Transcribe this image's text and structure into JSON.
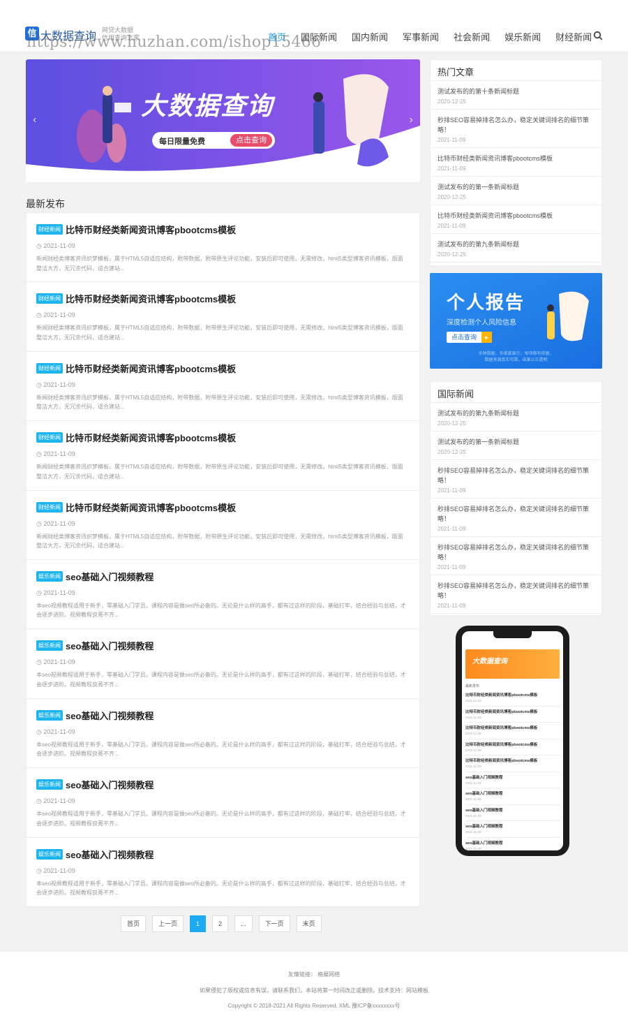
{
  "header": {
    "logo_icon": "信",
    "logo_name": "大数据查询",
    "slogan1": "网贷大数据",
    "slogan2": "信用查询之家",
    "watermark": "https://www.huzhan.com/ishop15466",
    "nav": [
      "首页",
      "国际新闻",
      "国内新闻",
      "军事新闻",
      "社会新闻",
      "娱乐新闻",
      "财经新闻"
    ],
    "active": "首页"
  },
  "banner": {
    "title": "大数据查询",
    "pill": "每日限量免费",
    "btn": "点击查询",
    "colors": {
      "bg1": "#5b4fe0",
      "bg2": "#8f54e8"
    }
  },
  "latest": {
    "title": "最新发布",
    "articles": [
      {
        "tag": "财经新闻",
        "title": "比特币财经类新闻资讯博客pbootcms模板",
        "date": "2021-11-09",
        "desc": "新闻财经类博客资讯织梦模板，属于HTML5自适应结构，附带数据，附带原生评论功能，安装后即可使用，无需修改。html5类型博客资讯模板，版面整洁大方，无冗余代码，适合建站..."
      },
      {
        "tag": "财经新闻",
        "title": "比特币财经类新闻资讯博客pbootcms模板",
        "date": "2021-11-09",
        "desc": "新闻财经类博客资讯织梦模板，属于HTML5自适应结构，附带数据，附带原生评论功能，安装后即可使用，无需修改。html5类型博客资讯模板，版面整洁大方，无冗余代码，适合建站..."
      },
      {
        "tag": "财经新闻",
        "title": "比特币财经类新闻资讯博客pbootcms模板",
        "date": "2021-11-09",
        "desc": "新闻财经类博客资讯织梦模板，属于HTML5自适应结构，附带数据，附带原生评论功能，安装后即可使用，无需修改。html5类型博客资讯模板，版面整洁大方，无冗余代码，适合建站..."
      },
      {
        "tag": "财经新闻",
        "title": "比特币财经类新闻资讯博客pbootcms模板",
        "date": "2021-11-09",
        "desc": "新闻财经类博客资讯织梦模板，属于HTML5自适应结构，附带数据，附带原生评论功能，安装后即可使用，无需修改。html5类型博客资讯模板，版面整洁大方，无冗余代码，适合建站..."
      },
      {
        "tag": "财经新闻",
        "title": "比特币财经类新闻资讯博客pbootcms模板",
        "date": "2021-11-09",
        "desc": "新闻财经类博客资讯织梦模板，属于HTML5自适应结构，附带数据，附带原生评论功能，安装后即可使用，无需修改。html5类型博客资讯模板，版面整洁大方，无冗余代码，适合建站..."
      },
      {
        "tag": "娱乐新闻",
        "title": "seo基础入门视频教程",
        "date": "2021-11-09",
        "desc": "本seo视频教程适用于新手，零基础入门学员。课程内容是做seo所必备的。无论是什么样的高手，都有过这样的阶段，基础打牢，结合经验与总结，才会逐步进阶。视频教程良莠不齐..."
      },
      {
        "tag": "娱乐新闻",
        "title": "seo基础入门视频教程",
        "date": "2021-11-09",
        "desc": "本seo视频教程适用于新手，零基础入门学员。课程内容是做seo所必备的。无论是什么样的高手，都有过这样的阶段，基础打牢，结合经验与总结，才会逐步进阶。视频教程良莠不齐..."
      },
      {
        "tag": "娱乐新闻",
        "title": "seo基础入门视频教程",
        "date": "2021-11-09",
        "desc": "本seo视频教程适用于新手，零基础入门学员。课程内容是做seo所必备的。无论是什么样的高手，都有过这样的阶段，基础打牢，结合经验与总结，才会逐步进阶。视频教程良莠不齐..."
      },
      {
        "tag": "娱乐新闻",
        "title": "seo基础入门视频教程",
        "date": "2021-11-09",
        "desc": "本seo视频教程适用于新手，零基础入门学员。课程内容是做seo所必备的。无论是什么样的高手，都有过这样的阶段，基础打牢，结合经验与总结，才会逐步进阶。视频教程良莠不齐..."
      },
      {
        "tag": "娱乐新闻",
        "title": "seo基础入门视频教程",
        "date": "2021-11-09",
        "desc": "本seo视频教程适用于新手，零基础入门学员。课程内容是做seo所必备的。无论是什么样的高手，都有过这样的阶段，基础打牢，结合经验与总结，才会逐步进阶。视频教程良莠不齐..."
      }
    ],
    "tag_colors": {
      "财经新闻": "#1eb4f0",
      "娱乐新闻": "#1eb4f0"
    }
  },
  "pager": {
    "items": [
      "首页",
      "上一页",
      "1",
      "2",
      "...",
      "下一页",
      "末页"
    ],
    "current": "1"
  },
  "hot": {
    "title": "热门文章",
    "items": [
      {
        "t": "测试发布的的第十条新闻标题",
        "d": "2020-12-25"
      },
      {
        "t": "秒排SEO容易掉排名怎么办，稳定关键词排名的细节策略！",
        "d": "2021-11-09"
      },
      {
        "t": "比特币财经类新闻资讯博客pbootcms模板",
        "d": "2021-11-09"
      },
      {
        "t": "测试发布的的第一条新闻标题",
        "d": "2020-12-25"
      },
      {
        "t": "比特币财经类新闻资讯博客pbootcms模板",
        "d": "2021-11-09"
      },
      {
        "t": "测试发布的的第九条新闻标题",
        "d": "2020-12-25"
      }
    ]
  },
  "ad": {
    "title": "个人报告",
    "sub": "深度检测个人风险信息",
    "btn": "点击查询",
    "fine1": "多种数据，多维度展示，每项都有依据，",
    "fine2": "数据来源真实可靠，结果公正透明"
  },
  "intl": {
    "title": "国际新闻",
    "items": [
      {
        "t": "测试发布的的第九条新闻标题",
        "d": "2020-12-25"
      },
      {
        "t": "测试发布的的第一条新闻标题",
        "d": "2020-12-25"
      },
      {
        "t": "秒排SEO容易掉排名怎么办，稳定关键词排名的细节策略！",
        "d": "2021-11-09"
      },
      {
        "t": "秒排SEO容易掉排名怎么办，稳定关键词排名的细节策略！",
        "d": "2021-11-09"
      },
      {
        "t": "秒排SEO容易掉排名怎么办，稳定关键词排名的细节策略！",
        "d": "2021-11-09"
      },
      {
        "t": "秒排SEO容易掉排名怎么办，稳定关键词排名的细节策略！",
        "d": "2021-11-09"
      }
    ]
  },
  "phone": {
    "banner_title": "大数据查询",
    "section": "最新发布",
    "items": [
      "比特币财经类新闻资讯博客pbootcms模板",
      "比特币财经类新闻资讯博客pbootcms模板",
      "比特币财经类新闻资讯博客pbootcms模板",
      "比特币财经类新闻资讯博客pbootcms模板",
      "比特币财经类新闻资讯博客pbootcms模板",
      "seo基础入门视频教程",
      "seo基础入门视频教程",
      "seo基础入门视频教程",
      "seo基础入门视频教程",
      "seo基础入门视频教程"
    ],
    "date": "2021-11-09"
  },
  "footer": {
    "links_label": "友情链接：",
    "link1": "格展网络",
    "notice": "如果侵犯了版权或信息有误，请联系我们，本站将第一时间改正或删除。技术支持：网站模板",
    "copyright": "Copyright © 2018-2021 All Rights Reserved. XML 豫ICP备xxxxxxxx号"
  }
}
